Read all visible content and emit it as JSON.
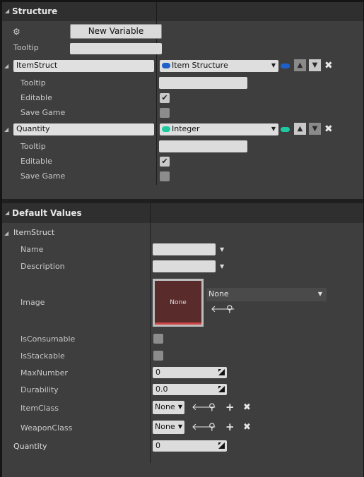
{
  "structure": {
    "header": "Structure",
    "new_variable_label": "New Variable",
    "tooltip_label": "Tooltip",
    "variables": [
      {
        "name": "ItemStruct",
        "type": "Item Structure",
        "type_color": "#1e5fc8",
        "tooltip_label": "Tooltip",
        "editable_label": "Editable",
        "save_game_label": "Save Game",
        "editable_checked": true,
        "save_game_checked": false
      },
      {
        "name": "Quantity",
        "type": "Integer",
        "type_color": "#1fc9a0",
        "tooltip_label": "Tooltip",
        "editable_label": "Editable",
        "save_game_label": "Save Game",
        "editable_checked": true,
        "save_game_checked": false
      }
    ]
  },
  "defaults": {
    "header": "Default Values",
    "group_label": "ItemStruct",
    "fields": {
      "name_label": "Name",
      "description_label": "Description",
      "image_label": "Image",
      "image_thumb_text": "None",
      "image_value": "None",
      "is_consumable_label": "IsConsumable",
      "is_stackable_label": "IsStackable",
      "max_number_label": "MaxNumber",
      "max_number_value": "0",
      "durability_label": "Durability",
      "durability_value": "0.0",
      "item_class_label": "ItemClass",
      "item_class_value": "None",
      "weapon_class_label": "WeaponClass",
      "weapon_class_value": "None"
    },
    "quantity_label": "Quantity",
    "quantity_value": "0"
  },
  "icons": {
    "add_var": "gear-plus-icon",
    "move_up": "arrow-up-icon",
    "move_down": "arrow-down-icon",
    "remove": "close-icon",
    "use_selected": "arrow-left-icon",
    "browse": "search-icon",
    "new": "plus-icon",
    "clear": "close-icon"
  }
}
